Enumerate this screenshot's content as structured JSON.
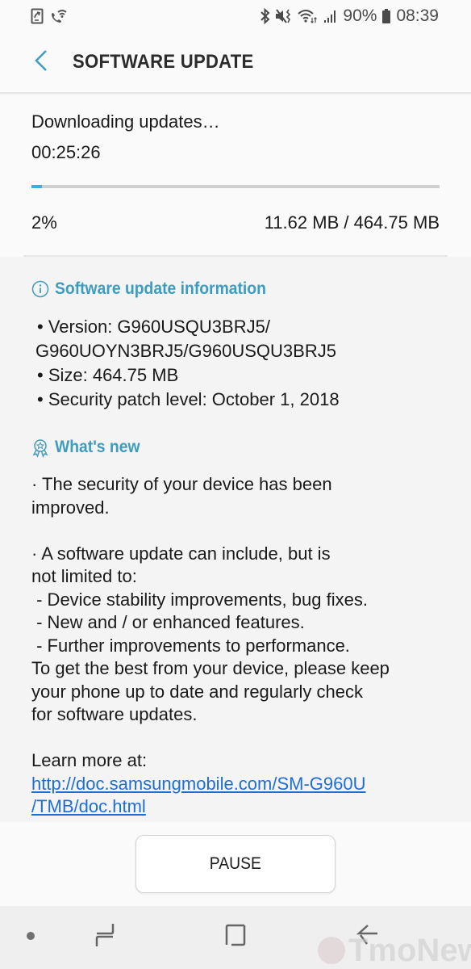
{
  "status_bar": {
    "left_icons": [
      "call-forward-icon",
      "wifi-calling-icon"
    ],
    "right_icons": [
      "bluetooth-icon",
      "vibrate-mute-icon",
      "wifi-data-icon",
      "signal-icon"
    ],
    "battery_percent": "90%",
    "battery_icon": "battery-icon",
    "time": "08:39"
  },
  "header": {
    "back_icon": "chevron-left-icon",
    "title": "SOFTWARE UPDATE"
  },
  "download": {
    "status": "Downloading updates…",
    "elapsed": "00:25:26",
    "progress_fraction": 0.025,
    "percent_label": "2%",
    "size_label": "11.62 MB / 464.75 MB",
    "accent_color": "#3aafdf"
  },
  "info_section": {
    "heading": "Software update information",
    "heading_icon": "info-icon",
    "heading_color": "#3e9cbf",
    "items": [
      "• Version: G960USQU3BRJ5/",
      "G960UOYN3BRJ5/G960USQU3BRJ5",
      "• Size: 464.75 MB",
      "• Security patch level: October 1, 2018"
    ]
  },
  "whats_new": {
    "heading": "What's new",
    "heading_icon": "award-ribbon-icon",
    "lines": [
      "· The security of your device has been",
      "improved.",
      "",
      "· A software update can include, but is",
      "not limited to:",
      " - Device stability improvements, bug fixes.",
      " - New and / or enhanced features.",
      " - Further improvements to performance.",
      "To get the best from your device, please keep",
      "your phone up to date and regularly check",
      "for software updates.",
      "",
      "Learn more at:"
    ],
    "link_lines": [
      "http://doc.samsungmobile.com/SM-G960U",
      "/TMB/doc.html"
    ],
    "link_color": "#1d6fd6"
  },
  "actions": {
    "pause_label": "PAUSE"
  },
  "nav_bar": {
    "items": [
      "dot-indicator-icon",
      "recents-icon",
      "home-icon",
      "back-arrow-icon"
    ]
  },
  "watermark": {
    "text": "TmoNews"
  }
}
